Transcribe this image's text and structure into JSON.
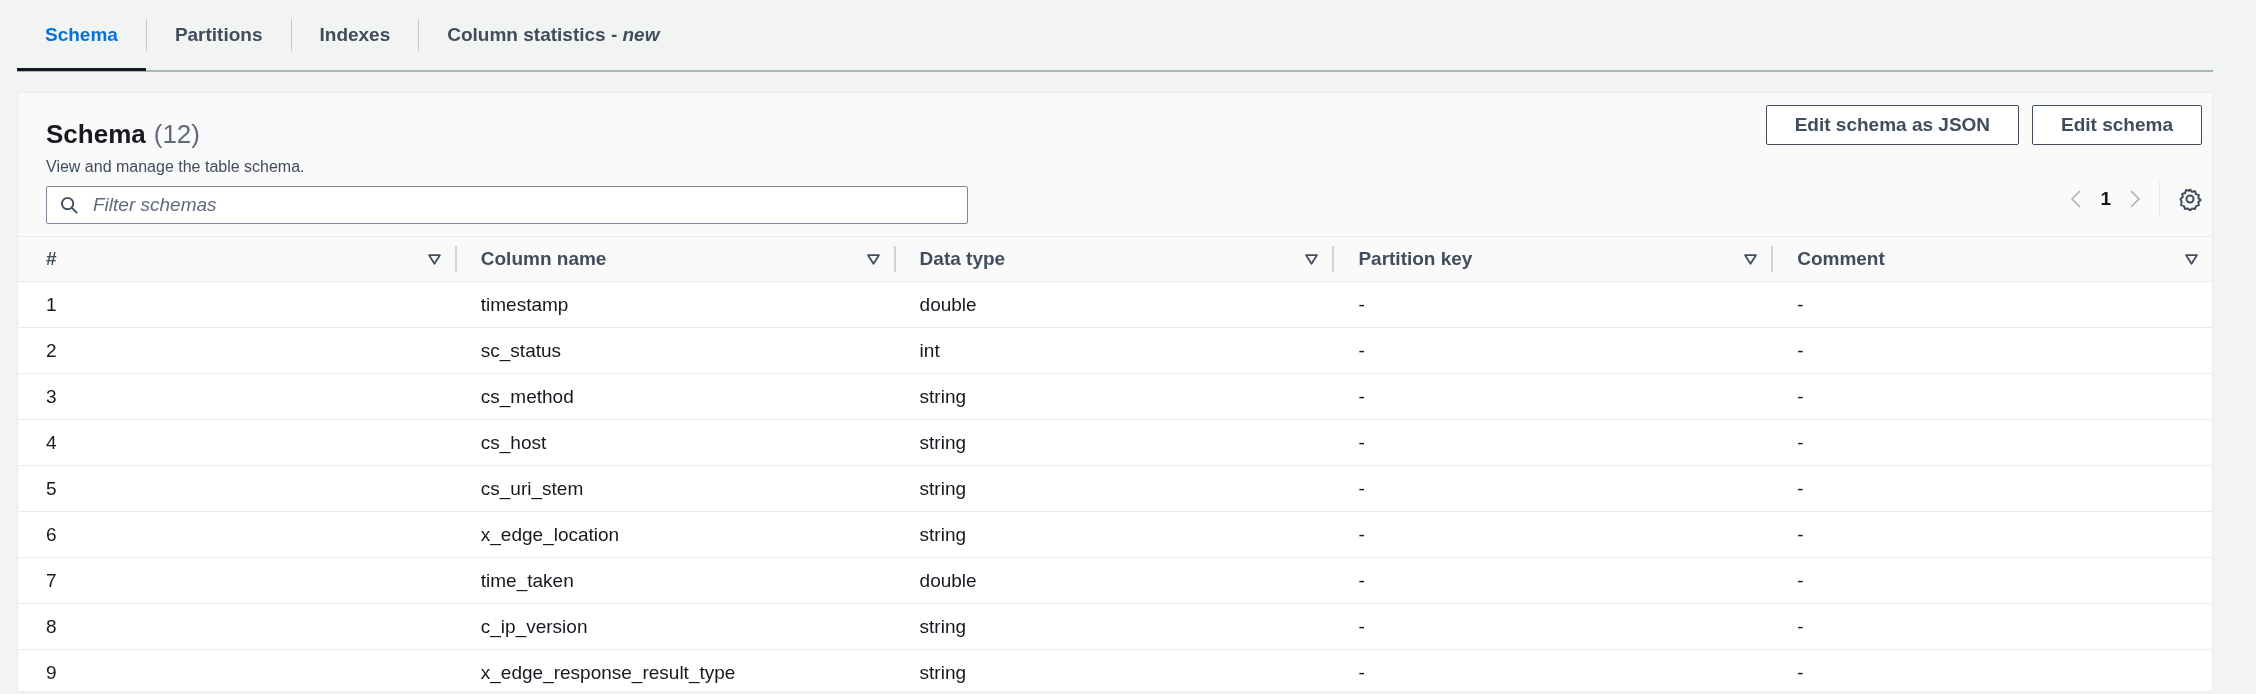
{
  "tabs": [
    {
      "label": "Schema",
      "selected": true
    },
    {
      "label": "Partitions",
      "selected": false
    },
    {
      "label": "Indexes",
      "selected": false
    },
    {
      "label": "Column statistics - *new*",
      "selected": false
    }
  ],
  "panel": {
    "title": "Schema",
    "count": "(12)",
    "description": "View and manage the table schema.",
    "buttons": [
      "Edit schema as JSON",
      "Edit schema"
    ],
    "search": {
      "placeholder": "Filter schemas"
    },
    "pagination": {
      "page": "1"
    }
  },
  "table": {
    "columns": [
      "#",
      "Column name",
      "Data type",
      "Partition key",
      "Comment"
    ],
    "rows": [
      [
        "1",
        "timestamp",
        "double",
        "-",
        "-"
      ],
      [
        "2",
        "sc_status",
        "int",
        "-",
        "-"
      ],
      [
        "3",
        "cs_method",
        "string",
        "-",
        "-"
      ],
      [
        "4",
        "cs_host",
        "string",
        "-",
        "-"
      ],
      [
        "5",
        "cs_uri_stem",
        "string",
        "-",
        "-"
      ],
      [
        "6",
        "x_edge_location",
        "string",
        "-",
        "-"
      ],
      [
        "7",
        "time_taken",
        "double",
        "-",
        "-"
      ],
      [
        "8",
        "c_ip_version",
        "string",
        "-",
        "-"
      ],
      [
        "9",
        "x_edge_response_result_type",
        "string",
        "-",
        "-"
      ]
    ]
  }
}
